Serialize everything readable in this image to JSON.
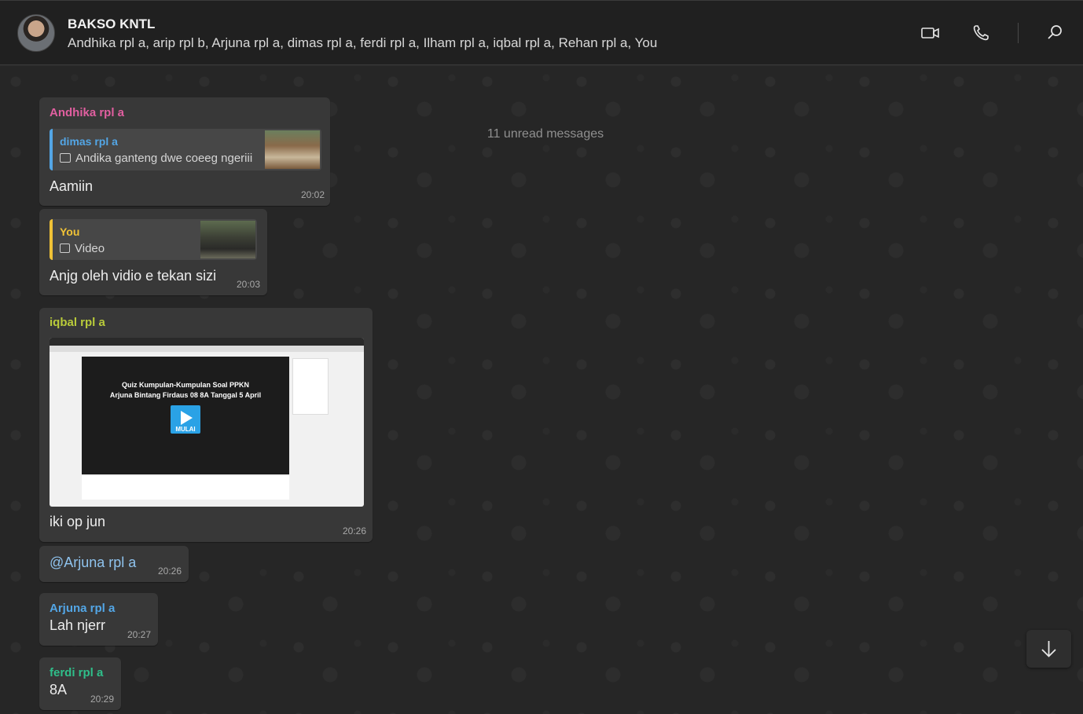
{
  "header": {
    "title": "BAKSO KNTL",
    "members": "Andhika rpl a, arip rpl b, Arjuna rpl a, dimas rpl a, ferdi rpl a, Ilham rpl a, iqbal rpl a, Rehan rpl a, You",
    "icons": [
      "video-call-icon",
      "voice-call-icon",
      "search-icon"
    ]
  },
  "chat": {
    "unread_label": "11 unread messages",
    "messages": [
      {
        "sender": "Andhika rpl a",
        "sender_color": "#e15fa0",
        "reply": {
          "name": "dimas rpl a",
          "name_color": "#53a6e6",
          "bar_color": "#53a6e6",
          "icon": "photo-icon",
          "text": "Andika ganteng dwe coeeg ngeriii"
        },
        "text": "Aamiin",
        "time": "20:02"
      },
      {
        "reply": {
          "name": "You",
          "name_color": "#f0c236",
          "bar_color": "#f0c236",
          "icon": "video-icon",
          "text": "Video"
        },
        "text": "Anjg oleh vidio e tekan sizi",
        "time": "20:03"
      },
      {
        "sender": "iqbal rpl a",
        "sender_color": "#b9cb3a",
        "media": {
          "type": "screenshot",
          "quiz_title": "Quiz Kumpulan-Kumpulan Soal PPKN",
          "quiz_subtitle": "Arjuna Bintang Firdaus 08 8A Tanggal 5 April",
          "play_label": "MULAI"
        },
        "text": "iki op jun",
        "time": "20:26"
      },
      {
        "text": "@Arjuna rpl a",
        "text_color": "#8fc3ee",
        "time": "20:26"
      },
      {
        "sender": "Arjuna rpl a",
        "sender_color": "#53a6e6",
        "text": "Lah njerr",
        "time": "20:27"
      },
      {
        "sender": "ferdi rpl a",
        "sender_color": "#2fbf8a",
        "text": "8A",
        "time": "20:29"
      }
    ]
  },
  "colors": {
    "header_bg": "#202020",
    "chat_bg": "#262626",
    "bubble_bg": "#383838",
    "quote_bg": "#474747"
  }
}
